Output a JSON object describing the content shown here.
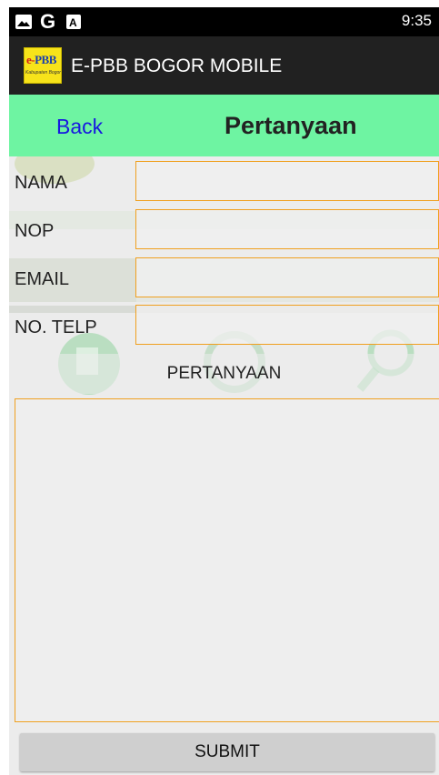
{
  "status_bar": {
    "time": "9:35",
    "icons": [
      "image-icon",
      "google-g-icon",
      "a-box-icon"
    ]
  },
  "app_bar": {
    "logo": {
      "line1": "PBB",
      "line1_prefix": "e-",
      "line2": "Kabupaten Bogor"
    },
    "title": "E-PBB BOGOR MOBILE"
  },
  "header": {
    "back_label": "Back",
    "title": "Pertanyaan"
  },
  "form": {
    "fields": [
      {
        "label": "NAMA",
        "value": ""
      },
      {
        "label": "NOP",
        "value": ""
      },
      {
        "label": "EMAIL",
        "value": ""
      },
      {
        "label": "NO. TELP",
        "value": ""
      }
    ],
    "question_label": "PERTANYAAN",
    "question_value": "",
    "submit_label": "SUBMIT"
  },
  "colors": {
    "header_bg": "#6ef4a2",
    "back_link": "#1818e0",
    "field_border": "#f0a020",
    "app_bar_bg": "#212121"
  }
}
